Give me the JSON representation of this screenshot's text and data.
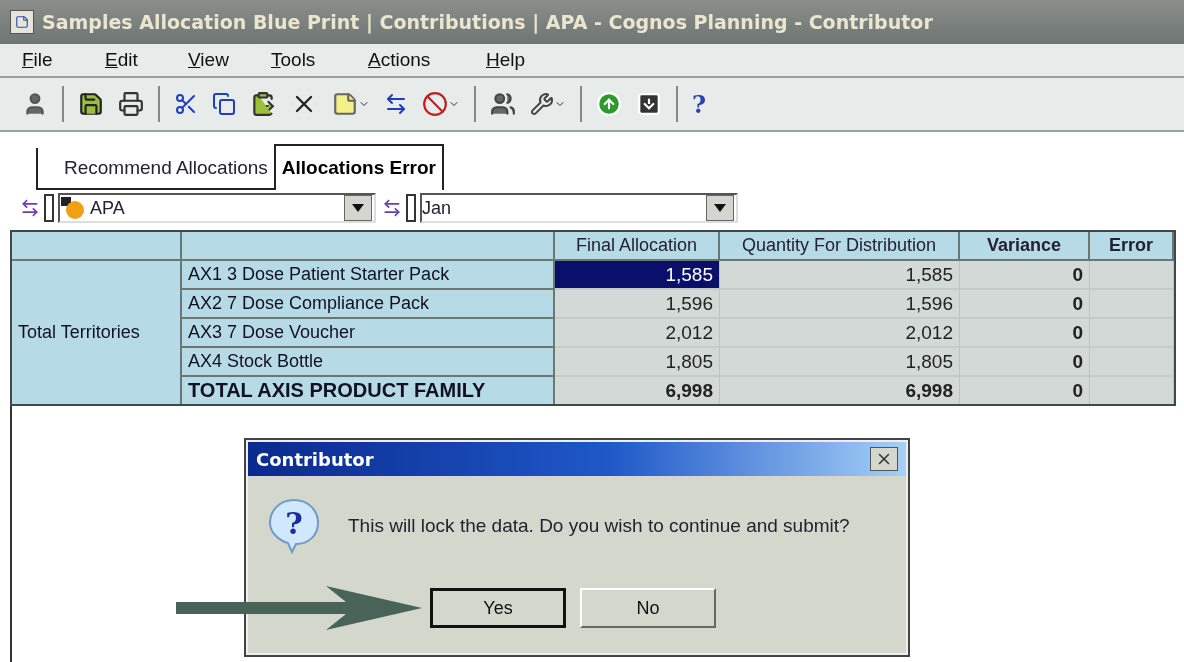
{
  "window": {
    "title": "Samples Allocation Blue Print | Contributions | APA - Cognos Planning - Contributor"
  },
  "menu": [
    "File",
    "Edit",
    "View",
    "Tools",
    "Actions",
    "Help"
  ],
  "toolbar": {
    "help_glyph": "?"
  },
  "tabs": [
    {
      "label": "Recommend Allocations",
      "selected": false
    },
    {
      "label": "Allocations Error",
      "selected": true
    }
  ],
  "selectors": [
    {
      "value": "APA",
      "kind": "entity"
    },
    {
      "value": "Jan",
      "kind": "period"
    }
  ],
  "table": {
    "columns": [
      "Final Allocation",
      "Quantity For Distribution",
      "Variance",
      "Error"
    ],
    "group_label": "Total Territories",
    "rows": [
      {
        "kind": "item",
        "product": "AX1 3 Dose Patient Starter Pack",
        "final_allocation": "1,585",
        "quantity": "1,585",
        "variance": "0",
        "selected": true
      },
      {
        "kind": "item",
        "product": "AX2 7 Dose Compliance Pack",
        "final_allocation": "1,596",
        "quantity": "1,596",
        "variance": "0",
        "selected": false
      },
      {
        "kind": "item",
        "product": "AX3 7 Dose Voucher",
        "final_allocation": "2,012",
        "quantity": "2,012",
        "variance": "0",
        "selected": false
      },
      {
        "kind": "item",
        "product": "AX4 Stock Bottle",
        "final_allocation": "1,805",
        "quantity": "1,805",
        "variance": "0",
        "selected": false
      },
      {
        "kind": "total",
        "product": "TOTAL AXIS PRODUCT FAMILY",
        "final_allocation": "6,998",
        "quantity": "6,998",
        "variance": "0",
        "selected": false
      }
    ]
  },
  "dialog": {
    "title": "Contributor",
    "icon_glyph": "?",
    "message": "This will lock the data. Do you wish to continue and submit?",
    "buttons": [
      {
        "label": "Yes",
        "focused": true
      },
      {
        "label": "No",
        "focused": false
      }
    ]
  }
}
